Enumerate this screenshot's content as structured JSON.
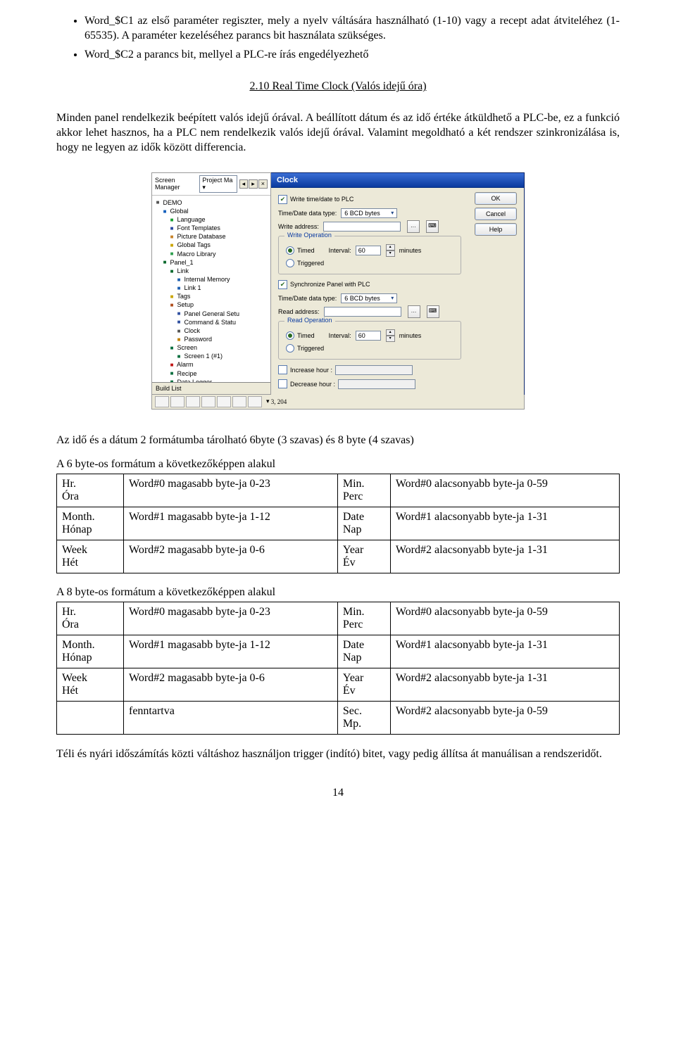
{
  "bullets": [
    "Word_$C1 az első paraméter regiszter, mely a nyelv váltására használható (1-10) vagy a recept adat átviteléhez (1-65535). A paraméter kezeléséhez parancs bit használata szükséges.",
    "Word_$C2 a parancs bit, mellyel a PLC-re írás engedélyezhető"
  ],
  "section_heading": "2.10 Real Time Clock (Valós idejű óra)",
  "intro_para": "Minden panel rendelkezik beépített valós idejű órával. A beállított dátum és az idő értéke átküldhető a PLC-be, ez a funkció akkor lehet hasznos, ha a PLC nem rendelkezik valós idejű órával. Valamint megoldható a két rendszer szinkronizálása is, hogy ne legyen az idők között differencia.",
  "shot": {
    "tree_title": "Screen Manager",
    "tree_dropdown": "Project Ma",
    "tree_nodes": [
      [
        "",
        "DEMO",
        "fold"
      ],
      [
        " ",
        "Global",
        "globe"
      ],
      [
        "  ",
        "Language",
        "lang"
      ],
      [
        "  ",
        "Font Templates",
        "font"
      ],
      [
        "  ",
        "Picture Database",
        "pic"
      ],
      [
        "  ",
        "Global Tags",
        "tag"
      ],
      [
        "  ",
        "Macro Library",
        "macro"
      ],
      [
        " ",
        "Panel_1",
        "panel"
      ],
      [
        "  ",
        "Link",
        "link"
      ],
      [
        "   ",
        "Internal Memory",
        "mem"
      ],
      [
        "   ",
        "Link 1",
        "mem"
      ],
      [
        "  ",
        "Tags",
        "tag"
      ],
      [
        "  ",
        "Setup",
        "setup"
      ],
      [
        "   ",
        "Panel General Setu",
        "gen"
      ],
      [
        "   ",
        "Command & Statu",
        "cmd"
      ],
      [
        "   ",
        "Clock",
        "clock"
      ],
      [
        "   ",
        "Password",
        "key"
      ],
      [
        "  ",
        "Screen",
        "scr"
      ],
      [
        "   ",
        "Screen 1 (#1)",
        "scr"
      ],
      [
        "  ",
        "Alarm",
        "alarm"
      ],
      [
        "  ",
        "Recipe",
        "rec"
      ],
      [
        "  ",
        "Data Logger",
        "dl"
      ]
    ],
    "build_label": "Build List",
    "tab_label": "Panel_1",
    "dlg_title": "Clock",
    "btn_ok": "OK",
    "btn_cancel": "Cancel",
    "btn_help": "Help",
    "chk_write": "Write time/date to PLC",
    "lbl_dtype": "Time/Date data type:",
    "sel_dtype": "6 BCD bytes",
    "lbl_waddr": "Write address:",
    "grp_write": "Write Operation",
    "rad_timed": "Timed",
    "lbl_int": "Interval:",
    "val_int": "60",
    "lbl_min": "minutes",
    "rad_trig": "Triggered",
    "chk_sync": "Synchronize Panel with PLC",
    "lbl_raddr": "Read address:",
    "grp_read": "Read Operation",
    "chk_inc": "Increase hour :",
    "chk_dec": "Decrease hour :",
    "status": "3, 204"
  },
  "after_shot_para": "Az idő és a dátum 2 formátumba tárolható 6byte (3 szavas) és 8 byte (4 szavas)",
  "t6_caption": "A 6 byte-os formátum a következőképpen alakul",
  "t6_rows": [
    [
      "Hr.\nÓra",
      "Word#0 magasabb byte-ja 0-23",
      "Min.\nPerc",
      "Word#0 alacsonyabb byte-ja 0-59"
    ],
    [
      "Month.\nHónap",
      "Word#1 magasabb byte-ja 1-12",
      "Date\nNap",
      "Word#1 alacsonyabb byte-ja 1-31"
    ],
    [
      "Week\nHét",
      "Word#2 magasabb byte-ja 0-6",
      "Year\nÉv",
      "Word#2 alacsonyabb byte-ja 1-31"
    ]
  ],
  "t8_caption": "A 8 byte-os formátum a következőképpen alakul",
  "t8_rows": [
    [
      "Hr.\nÓra",
      "Word#0 magasabb byte-ja 0-23",
      "Min.\nPerc",
      "Word#0 alacsonyabb byte-ja 0-59"
    ],
    [
      "Month.\nHónap",
      "Word#1 magasabb byte-ja 1-12",
      "Date\nNap",
      "Word#1 alacsonyabb byte-ja 1-31"
    ],
    [
      "Week\nHét",
      "Word#2 magasabb byte-ja 0-6",
      "Year\nÉv",
      "Word#2 alacsonyabb byte-ja 1-31"
    ],
    [
      "",
      "fenntartva",
      "Sec.\nMp.",
      "Word#2 alacsonyabb byte-ja 0-59"
    ]
  ],
  "closing_para": "Téli és nyári időszámítás közti váltáshoz használjon trigger (indító) bitet, vagy pedig állítsa át manuálisan a rendszeridőt.",
  "page_number": "14"
}
